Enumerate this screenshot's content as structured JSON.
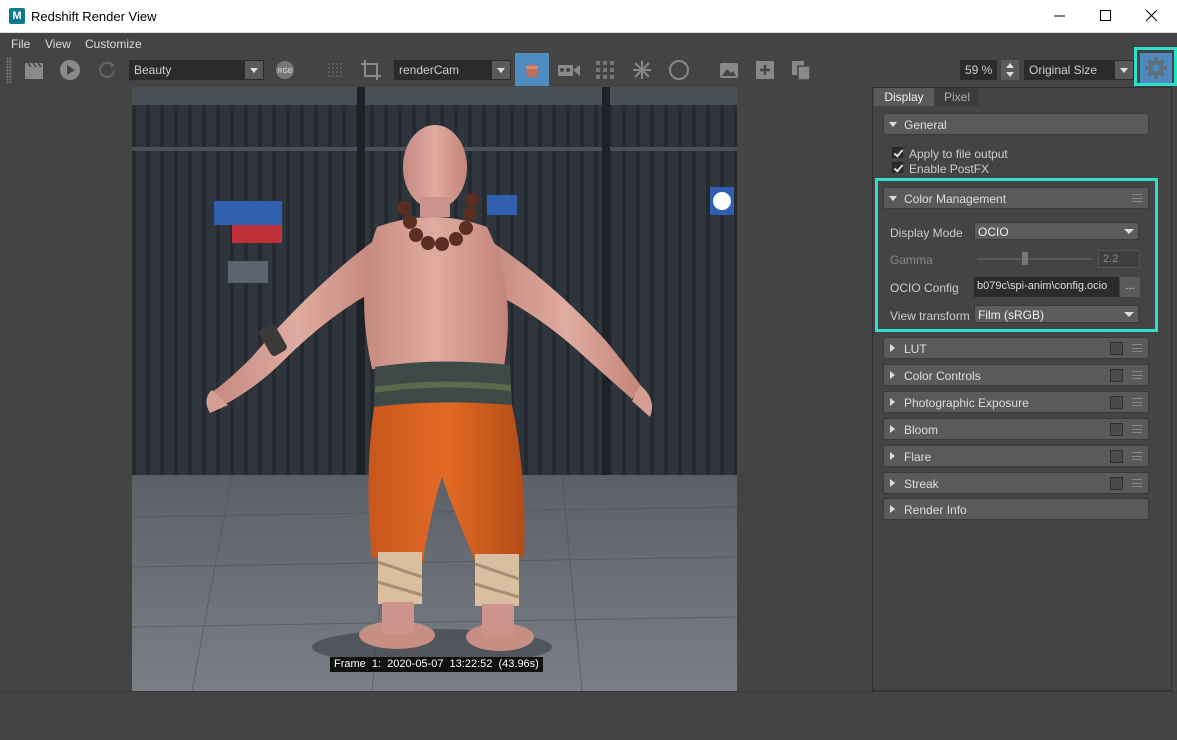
{
  "window": {
    "app_icon_letter": "M",
    "title": "Redshift Render View"
  },
  "menu": {
    "items": [
      "File",
      "View",
      "Customize"
    ]
  },
  "toolbar": {
    "aov_select": "Beauty",
    "color_chip": "RGB",
    "camera_select": "renderCam",
    "zoom_value": "59 %",
    "size_select": "Original Size"
  },
  "viewport": {
    "frame_label": "Frame  1:  2020-05-07  13:22:52  (43.96s)"
  },
  "panel": {
    "tabs": [
      "Display",
      "Pixel"
    ],
    "active_tab": "Display",
    "general": {
      "title": "General",
      "apply_to_file_output": "Apply to file output",
      "enable_postfx": "Enable PostFX"
    },
    "color_management": {
      "title": "Color Management",
      "display_mode_label": "Display Mode",
      "display_mode_value": "OCIO",
      "gamma_label": "Gamma",
      "gamma_value": "2.2",
      "ocio_config_label": "OCIO Config",
      "ocio_config_value": "b079c\\spi-anim\\config.ocio",
      "ocio_browse": "...",
      "view_transform_label": "View transform",
      "view_transform_value": "Film (sRGB)"
    },
    "sections": [
      {
        "title": "LUT"
      },
      {
        "title": "Color Controls"
      },
      {
        "title": "Photographic Exposure"
      },
      {
        "title": "Bloom"
      },
      {
        "title": "Flare"
      },
      {
        "title": "Streak"
      },
      {
        "title": "Render Info"
      }
    ]
  },
  "colors": {
    "highlight": "#2fe0c8",
    "active_button": "#4d8bc0"
  }
}
